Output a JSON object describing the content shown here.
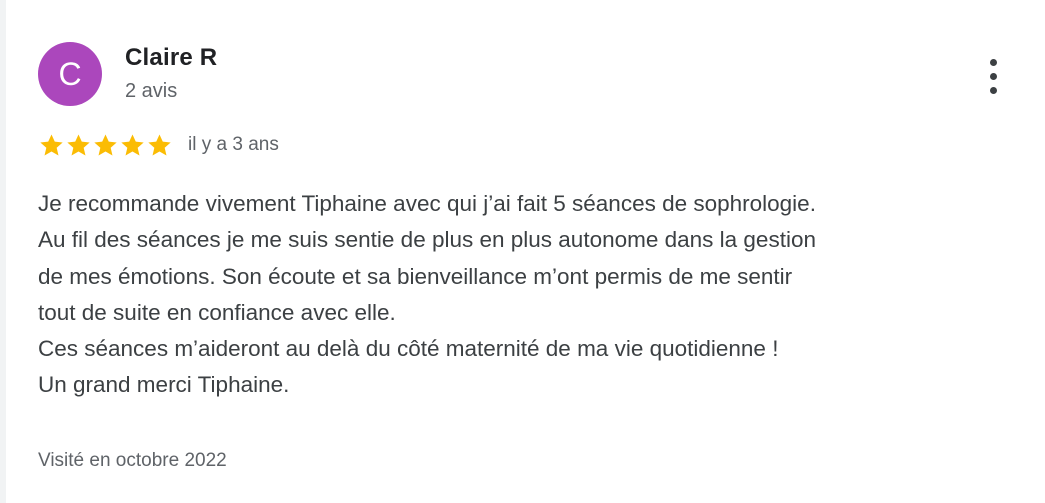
{
  "review": {
    "author": {
      "initial": "C",
      "name": "Claire R",
      "review_count": "2 avis",
      "avatar_color": "#ab47bc"
    },
    "more_options_icon": "more-vert-icon",
    "rating": 5,
    "max_rating": 5,
    "star_color": "#fbbc04",
    "relative_date": "il y a 3 ans",
    "text_lines": [
      "Je recommande vivement Tiphaine avec qui j’ai fait 5 séances de sophrologie.",
      "Au fil des séances je me suis sentie de plus en plus autonome dans la gestion",
      "de mes émotions. Son écoute et sa bienveillance m’ont permis de me sentir",
      "tout de suite en confiance avec elle.",
      "Ces séances m’aideront au delà du côté maternité de ma vie quotidienne !",
      "Un grand merci Tiphaine."
    ],
    "visit_date": "Visité en octobre 2022"
  }
}
